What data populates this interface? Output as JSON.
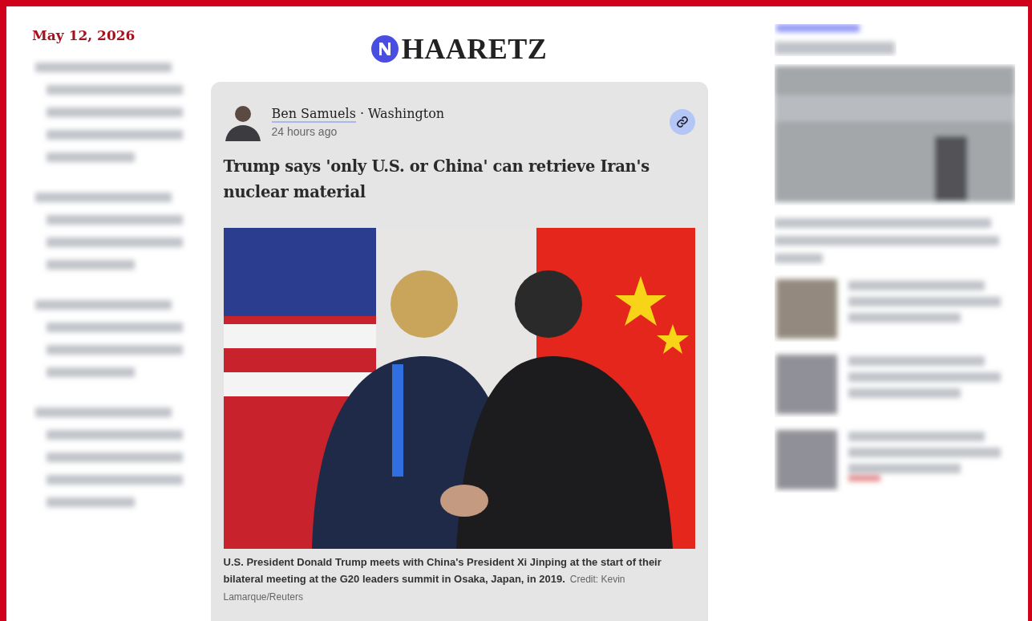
{
  "date": "May 12, 2026",
  "logo": {
    "text": "HAARETZ"
  },
  "article": {
    "author": "Ben Samuels",
    "separator": "·",
    "location": "Washington",
    "time": "24 hours ago",
    "headline": "Trump says 'only U.S. or China' can retrieve Iran's nuclear material",
    "caption": "U.S. President Donald Trump meets with China's President Xi Jinping at the start of their bilateral meeting at the G20 leaders summit in Osaka, Japan, in 2019.",
    "credit": "Credit: Kevin Lamarque/Reuters"
  }
}
